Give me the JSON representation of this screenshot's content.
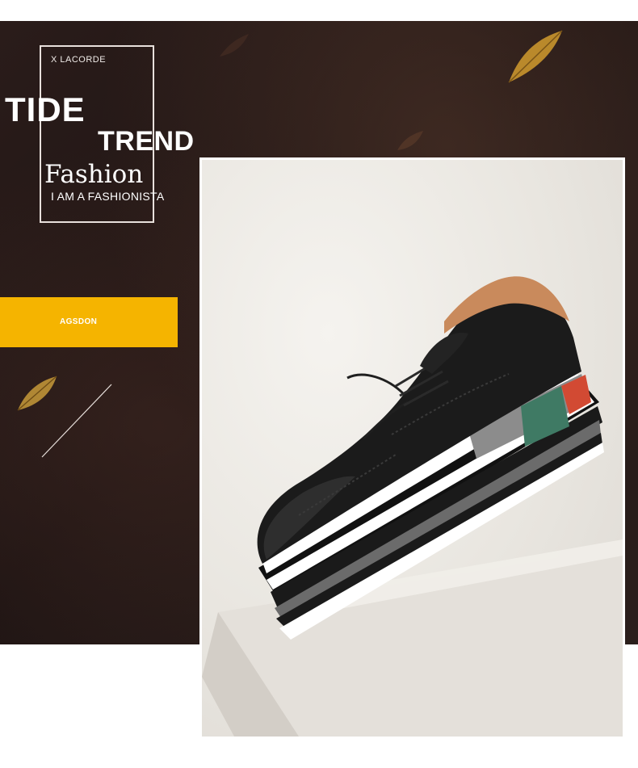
{
  "header": {
    "brand_small": "X LACORDE",
    "headline_1": "TIDE",
    "headline_2": "TREND",
    "script_word": "Fashion",
    "tagline": "I AM A FASHIONISTA"
  },
  "badge": {
    "label": "AGSDON",
    "color": "#f5b400"
  },
  "colors": {
    "banner_dark": "#231816",
    "accent_gold": "#c9952e",
    "sole_green": "#3f7a64",
    "sole_red": "#d24a33"
  },
  "icons": {
    "leaf": "leaf-decoration",
    "line": "diagonal-line"
  },
  "photo": {
    "subject": "shoe-photo"
  }
}
